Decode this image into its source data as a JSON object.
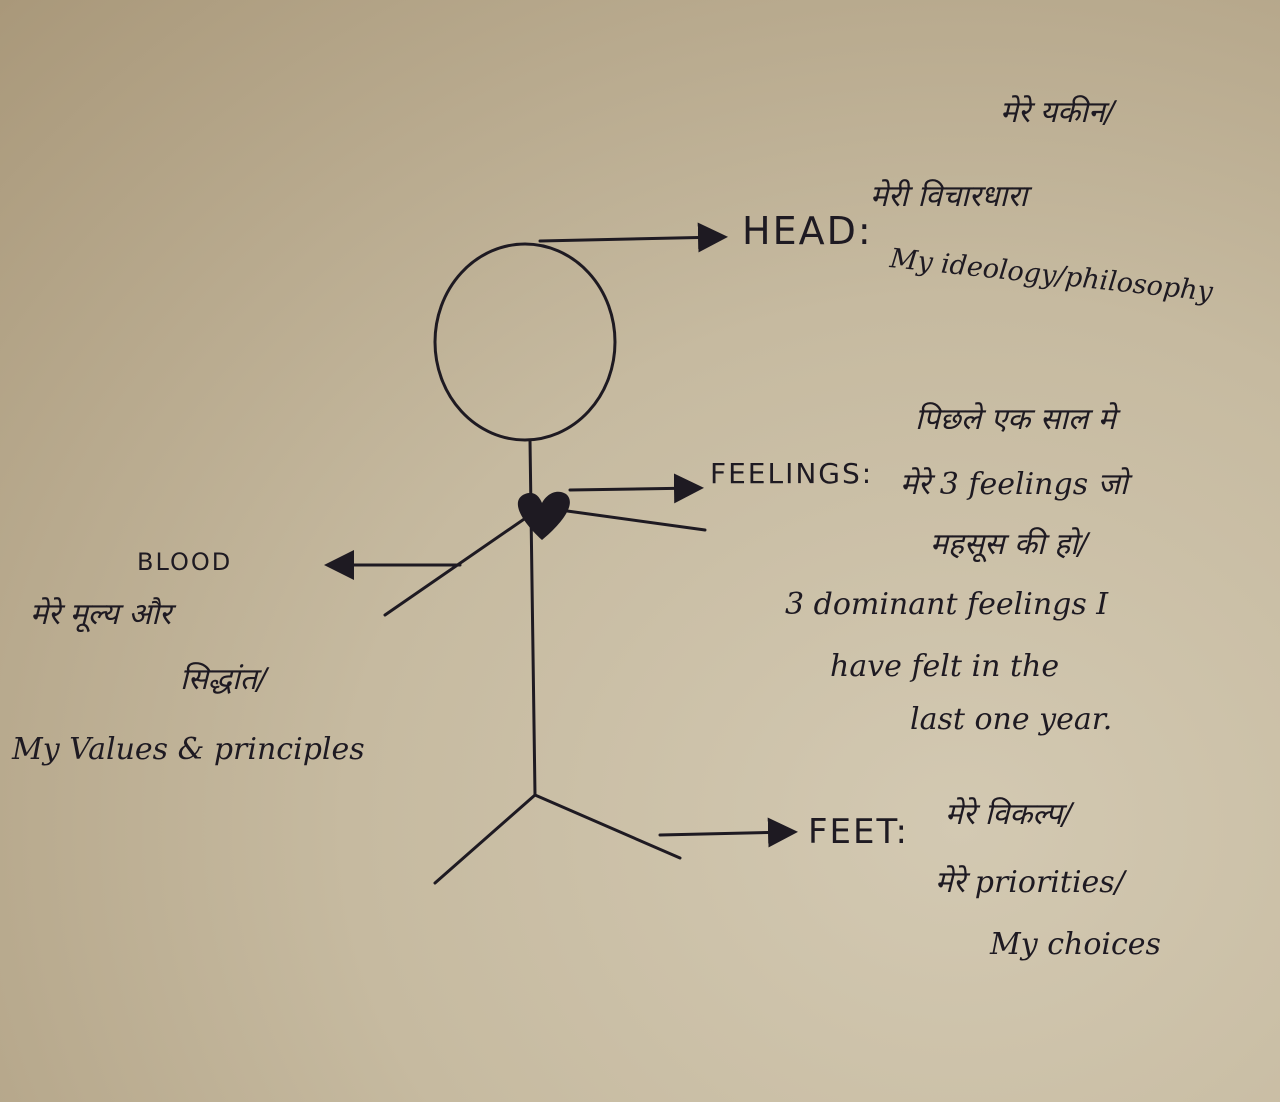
{
  "head": {
    "label": "HEAD:",
    "hindi_line1": "मेरे यकीन/",
    "hindi_line2": "मेरी विचारधारा",
    "english": "My ideology/philosophy"
  },
  "feelings": {
    "label": "FEELINGS:",
    "hindi_line1": "पिछले एक साल मे",
    "hindi_line2": "मेरे 3 feelings जो",
    "hindi_line3": "महसूस की हो/",
    "english_line1": "3 dominant feelings I",
    "english_line2": "have felt in the",
    "english_line3": "last one year."
  },
  "blood": {
    "label": "BLOOD",
    "hindi_line1": "मेरे मूल्य और",
    "hindi_line2": "सिद्धांत/",
    "english": "My Values & principles"
  },
  "feet": {
    "label": "FEET:",
    "hindi_line1": "मेरे विकल्प/",
    "hindi_line2": "मेरे priorities/",
    "english": "My choices"
  },
  "colors": {
    "ink": "#1e1a22",
    "paper": "#c6baa0"
  }
}
